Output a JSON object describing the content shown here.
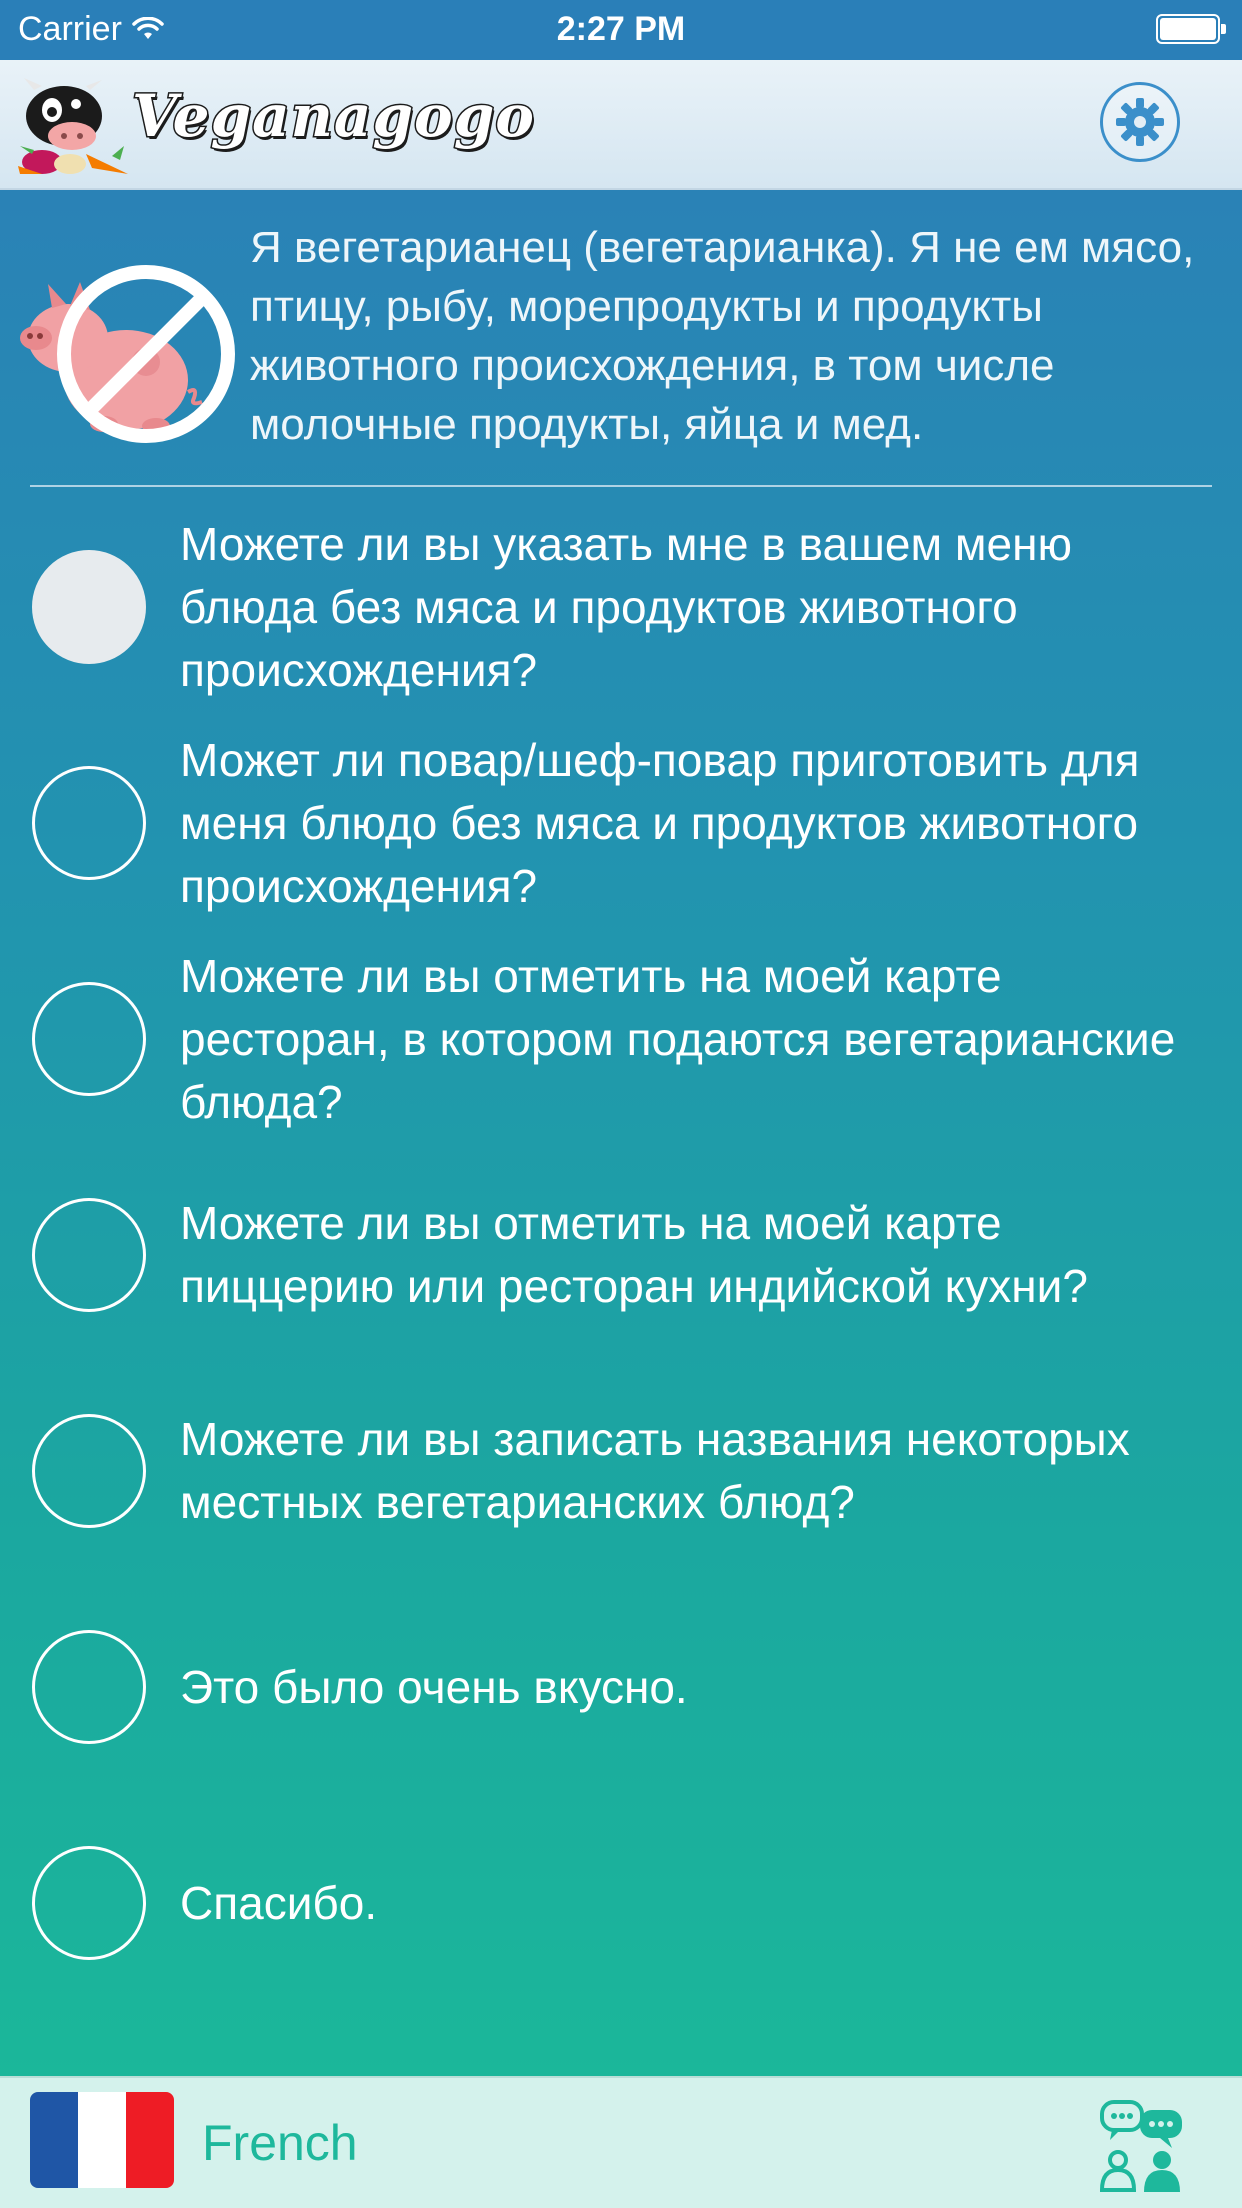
{
  "status_bar": {
    "carrier": "Carrier",
    "time": "2:27 PM"
  },
  "header": {
    "app_name": "Veganagogo"
  },
  "intro": {
    "text": "Я вегетарианец (вегетарианка). Я не ем мясо, птицу, рыбу, морепродукты и продукты животного происхождения, в том числе молочные продукты, яйца и мед."
  },
  "phrases": [
    {
      "text": "Можете ли вы указать мне в вашем меню блюда без мяса и продуктов животного происхождения?",
      "selected": true
    },
    {
      "text": "Может ли повар/шеф-повар приготовить для меня блюдо без мяса и продуктов животного происхождения?",
      "selected": false
    },
    {
      "text": "Можете ли вы отметить на моей карте ресторан, в котором подаются вегетарианские блюда?",
      "selected": false
    },
    {
      "text": "Можете ли вы отметить на моей карте пиццерию или ресторан индийской кухни?",
      "selected": false
    },
    {
      "text": "Можете ли вы записать названия некоторых местных вегетарианских блюд?",
      "selected": false
    },
    {
      "text": "Это было очень вкусно.",
      "selected": false
    },
    {
      "text": "Спасибо.",
      "selected": false
    }
  ],
  "bottom_bar": {
    "language": "French"
  },
  "icons": {
    "status": [
      "wifi-icon",
      "battery-icon"
    ],
    "header": [
      "cow-logo-icon",
      "gear-icon"
    ],
    "intro": "no-pig-icon",
    "bottom": [
      "french-flag-icon",
      "conversation-icon"
    ]
  },
  "colors": {
    "status_bar": "#2a7fb8",
    "accent_blue": "#3b8fca",
    "gradient_top": "#2a82b6",
    "gradient_bottom": "#1bb79a",
    "bottom_bar": "#d4f2ec",
    "language_text": "#1eb89c",
    "flag_blue": "#1f56a6",
    "flag_white": "#ffffff",
    "flag_red": "#ee1c25"
  }
}
